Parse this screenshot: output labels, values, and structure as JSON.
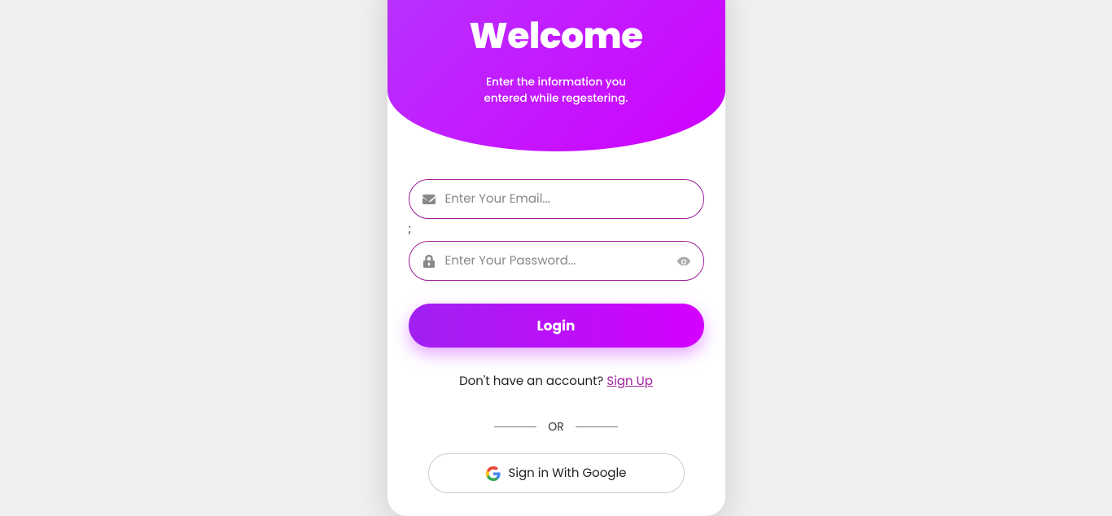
{
  "header": {
    "title": "Welcome",
    "subtitle": "Enter the information you entered while regestering."
  },
  "form": {
    "email_placeholder": "Enter Your Email...",
    "stray_text": ";",
    "password_placeholder": "Enter Your Password...",
    "login_label": "Login"
  },
  "signup": {
    "prompt": "Don't have an account? ",
    "link_label": "Sign Up"
  },
  "divider": {
    "label": "OR"
  },
  "google": {
    "label": "Sign in With Google"
  },
  "colors": {
    "gradient_start": "#a020f0",
    "gradient_end": "#d400ff",
    "border": "#a020a0"
  }
}
